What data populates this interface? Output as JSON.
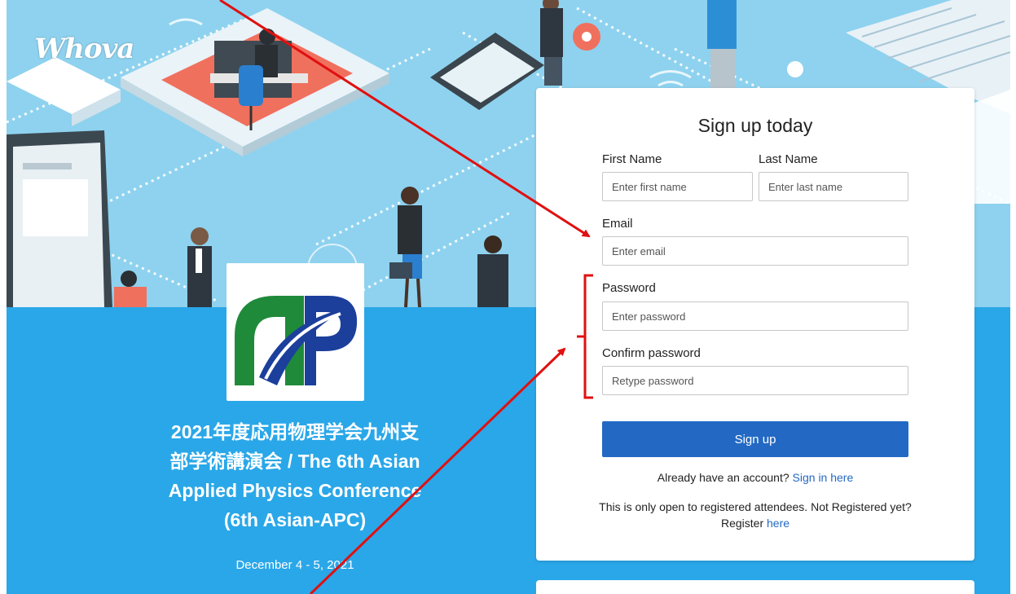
{
  "brand": {
    "logo_text": "Whova"
  },
  "event": {
    "title_line1": "2021年度応用物理学会九州支",
    "title_line2": "部学術講演会 / The 6th Asian",
    "title_line3": "Applied Physics Conference",
    "title_line4": "(6th Asian-APC)",
    "date": "December 4 - 5, 2021"
  },
  "signup": {
    "heading": "Sign up today",
    "first_name_label": "First Name",
    "first_name_placeholder": "Enter first name",
    "last_name_label": "Last Name",
    "last_name_placeholder": "Enter last name",
    "email_label": "Email",
    "email_placeholder": "Enter email",
    "password_label": "Password",
    "password_placeholder": "Enter password",
    "confirm_label": "Confirm password",
    "confirm_placeholder": "Retype password",
    "button_label": "Sign up",
    "already_text": "Already have an account?",
    "signin_link": "Sign in here",
    "registered_note": "This is only open to registered attendees. Not Registered yet?",
    "register_text": "Register",
    "register_link": "here"
  },
  "colors": {
    "accent": "#2369c4",
    "band": "#2aa7e8",
    "annotation": "#e01010"
  },
  "icons": [
    "org-logo-icon",
    "hero-illustration"
  ]
}
